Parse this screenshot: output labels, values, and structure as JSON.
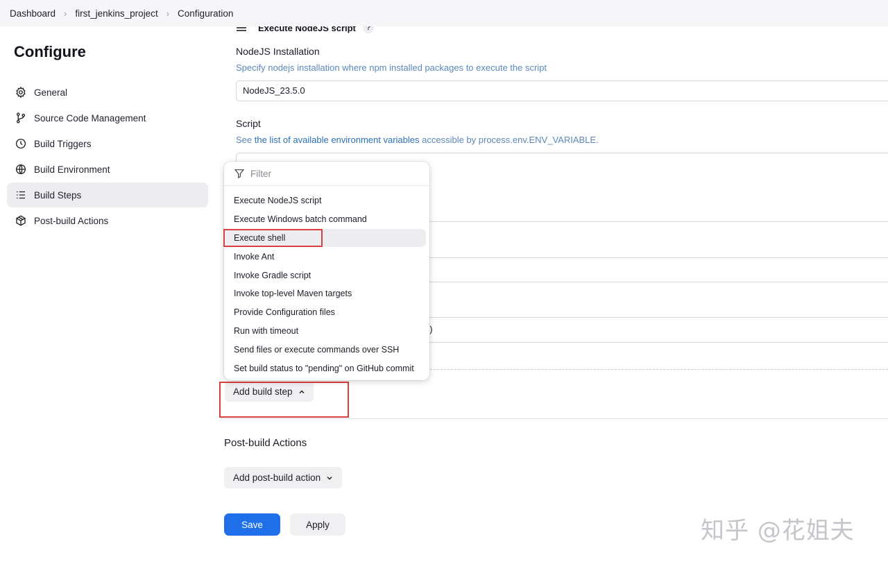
{
  "breadcrumb": [
    "Dashboard",
    "first_jenkins_project",
    "Configuration"
  ],
  "page_title": "Configure",
  "sidebar": {
    "items": [
      {
        "label": "General",
        "icon": "gear-icon"
      },
      {
        "label": "Source Code Management",
        "icon": "branch-icon"
      },
      {
        "label": "Build Triggers",
        "icon": "clock-icon"
      },
      {
        "label": "Build Environment",
        "icon": "globe-icon"
      },
      {
        "label": "Build Steps",
        "icon": "list-icon",
        "active": true
      },
      {
        "label": "Post-build Actions",
        "icon": "package-icon"
      }
    ]
  },
  "build_step": {
    "title": "Execute NodeJS script",
    "help": "?",
    "installation_label": "NodeJS Installation",
    "installation_desc": "Specify nodejs installation where npm installed packages to execute the script",
    "installation_value": "NodeJS_23.5.0",
    "script_label": "Script",
    "script_desc_prefix": "See ",
    "script_desc_link": "the list of available environment variables",
    "script_desc_suffix": " accessible by process.env.ENV_VARIABLE.",
    "partial_text": "e)"
  },
  "dropdown": {
    "filter_placeholder": "Filter",
    "items": [
      "Execute NodeJS script",
      "Execute Windows batch command",
      "Execute shell",
      "Invoke Ant",
      "Invoke Gradle script",
      "Invoke top-level Maven targets",
      "Provide Configuration files",
      "Run with timeout",
      "Send files or execute commands over SSH",
      "Set build status to \"pending\" on GitHub commit"
    ]
  },
  "add_build_step_label": "Add build step",
  "post_build": {
    "title": "Post-build Actions",
    "add_label": "Add post-build action"
  },
  "buttons": {
    "save": "Save",
    "apply": "Apply"
  },
  "watermark": "知乎 @花姐夫",
  "colors": {
    "primary": "#1f6fe8",
    "highlight": "#d94040",
    "link": "#2a6fb5"
  }
}
